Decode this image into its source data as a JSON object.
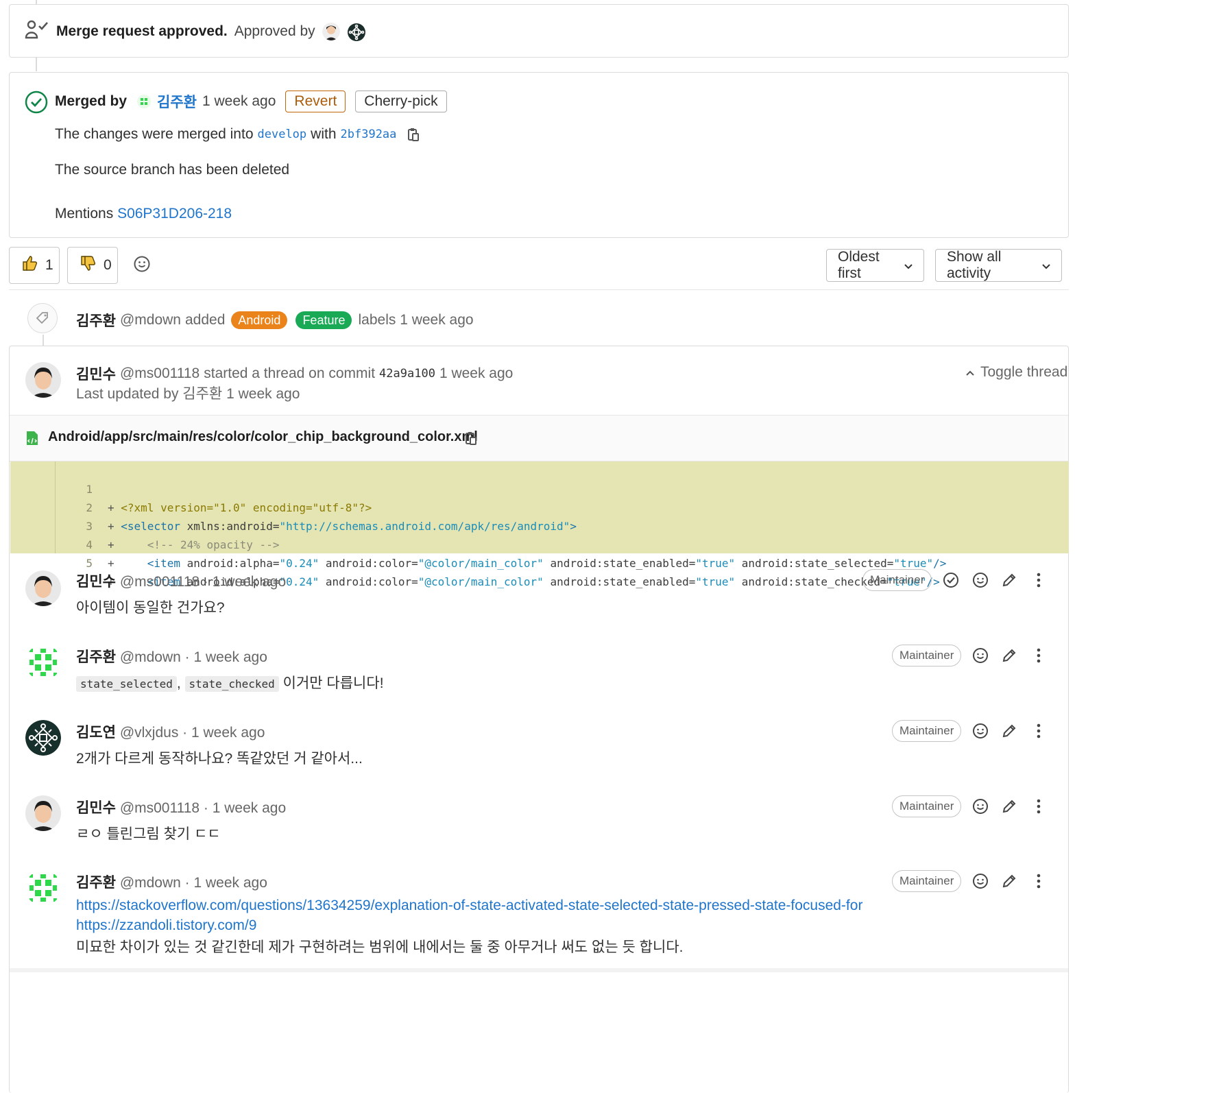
{
  "approval": {
    "title": "Merge request approved.",
    "approved_by": "Approved by"
  },
  "merged": {
    "merged_by": "Merged by",
    "user": "김주환",
    "time": "1 week ago",
    "revert_label": "Revert",
    "cherry_pick_label": "Cherry-pick",
    "changes_prefix": "The changes were merged into",
    "branch": "develop",
    "with_label": "with",
    "commit": "2bf392aa",
    "deleted_text": "The source branch has been deleted",
    "mentions_label": "Mentions",
    "mentions_link": "S06P31D206-218"
  },
  "reactions": {
    "thumbs_up_count": "1",
    "thumbs_down_count": "0"
  },
  "filters": {
    "sort_label": "Oldest first",
    "activity_label": "Show all activity"
  },
  "label_event": {
    "user": "김주환",
    "handle": "@mdown",
    "action": "added",
    "labels": [
      {
        "name": "Android",
        "color": "#e9831a"
      },
      {
        "name": "Feature",
        "color": "#1aaa55"
      }
    ],
    "suffix": "labels 1 week ago"
  },
  "thread": {
    "user": "김민수",
    "handle": "@ms001118",
    "action": "started a thread on commit",
    "commit": "42a9a100",
    "time": "1 week ago",
    "last_updated": "Last updated by 김주환 1 week ago",
    "toggle_label": "Toggle thread",
    "file_path": "Android/app/src/main/res/color/color_chip_background_color.xml"
  },
  "diff_lines": [
    {
      "num": "1"
    },
    {
      "num": "2"
    },
    {
      "num": "3"
    },
    {
      "num": "4"
    },
    {
      "num": "5"
    }
  ],
  "notes": [
    {
      "user": "김민수",
      "meta": "@ms001118 · 1 week ago",
      "role": "Maintainer",
      "body": "아이템이 동일한 건가요?"
    },
    {
      "user": "김주환",
      "meta": "@mdown · 1 week ago",
      "role": "Maintainer",
      "code1": "state_selected",
      "sep": ",",
      "code2": "state_checked",
      "body": "이거만 다릅니다!"
    },
    {
      "user": "김도연",
      "meta": "@vlxjdus · 1 week ago",
      "role": "Maintainer",
      "body": "2개가 다르게 동작하나요? 똑같았던 거 같아서..."
    },
    {
      "user": "김민수",
      "meta": "@ms001118 · 1 week ago",
      "role": "Maintainer",
      "body": "ㄹㅇ 틀린그림 찾기 ㄷㄷ"
    },
    {
      "user": "김주환",
      "meta": "@mdown · 1 week ago",
      "role": "Maintainer",
      "link1": "https://stackoverflow.com/questions/13634259/explanation-of-state-activated-state-selected-state-pressed-state-focused-for",
      "link2": "https://zzandoli.tistory.com/9",
      "body": "미묘한 차이가 있는 것 같긴한데 제가 구현하려는 범위에 내에서는 둘 중 아무거나 써도 없는 듯 합니다."
    }
  ],
  "colors": {
    "link": "#1f75cb",
    "success": "#108548",
    "diff_added_bg": "#e5e5b4"
  }
}
